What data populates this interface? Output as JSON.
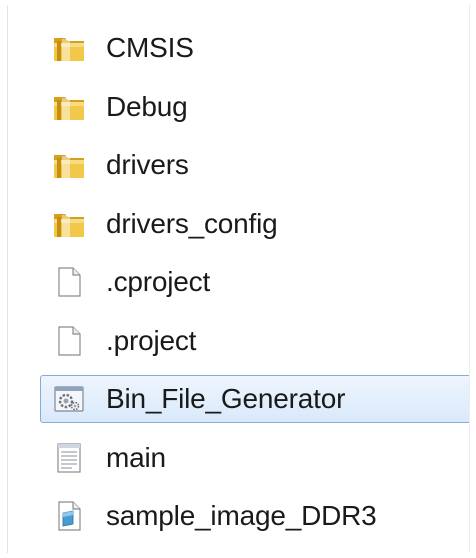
{
  "file_list": {
    "items": [
      {
        "name": "CMSIS",
        "type": "folder",
        "icon": "folder-icon",
        "selected": false
      },
      {
        "name": "Debug",
        "type": "folder",
        "icon": "folder-icon",
        "selected": false
      },
      {
        "name": "drivers",
        "type": "folder",
        "icon": "folder-icon",
        "selected": false
      },
      {
        "name": "drivers_config",
        "type": "folder",
        "icon": "folder-icon",
        "selected": false
      },
      {
        "name": ".cproject",
        "type": "file",
        "icon": "blank-file-icon",
        "selected": false
      },
      {
        "name": ".project",
        "type": "file",
        "icon": "blank-file-icon",
        "selected": false
      },
      {
        "name": "Bin_File_Generator",
        "type": "application",
        "icon": "application-icon",
        "selected": true
      },
      {
        "name": "main",
        "type": "text-file",
        "icon": "text-file-icon",
        "selected": false
      },
      {
        "name": "sample_image_DDR3",
        "type": "image-file",
        "icon": "image-file-icon",
        "selected": false
      }
    ]
  },
  "colors": {
    "selection_fill": "#d9e9fb",
    "selection_border": "#84acdd",
    "folder_yellow": "#e8b73a",
    "text": "#1a1a1a"
  }
}
